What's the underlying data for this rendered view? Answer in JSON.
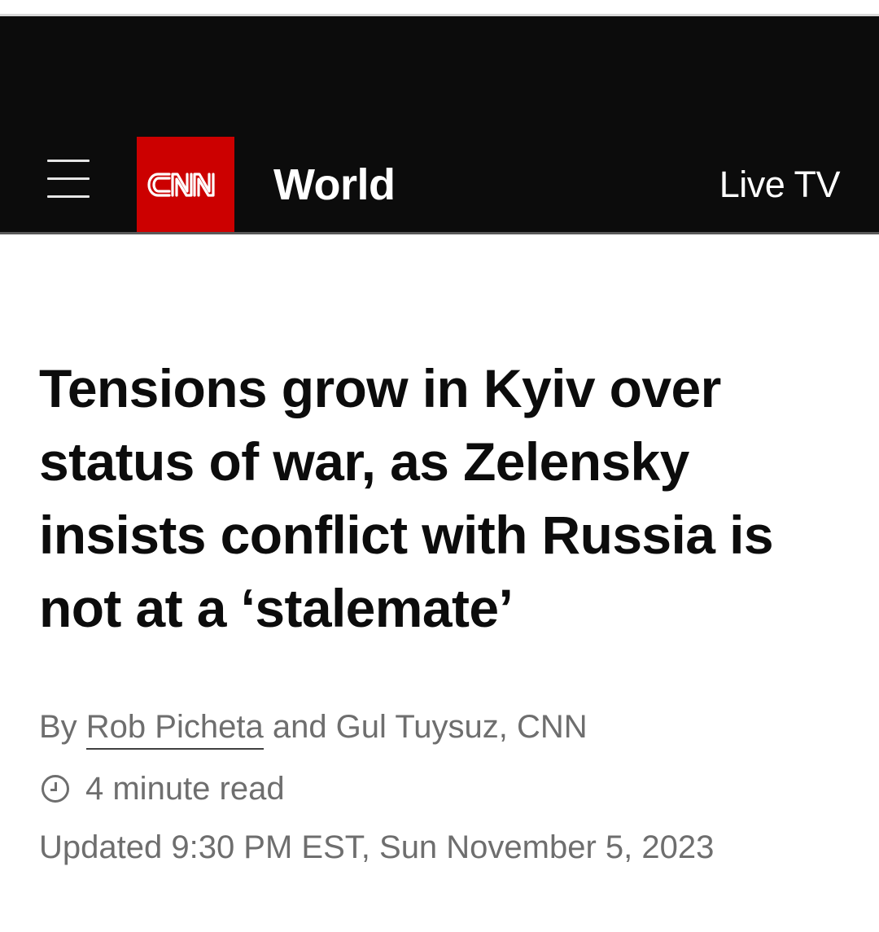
{
  "header": {
    "logo_text": "CNN",
    "section_title": "World",
    "live_tv_label": "Live TV",
    "menu_icon": "hamburger-menu-icon",
    "background_color": "#0c0c0c",
    "logo_color": "#cc0000"
  },
  "article": {
    "headline": "Tensions grow in Kyiv over status of war, as Zelensky insists conflict with Russia is not at a ‘stalemate’",
    "byline": {
      "prefix": "By ",
      "author_link": "Rob Picheta",
      "rest": " and Gul Tuysuz, CNN"
    },
    "read_time": "4 minute read",
    "read_time_icon": "clock-icon",
    "updated": "Updated 9:30 PM EST, Sun November 5, 2023"
  }
}
